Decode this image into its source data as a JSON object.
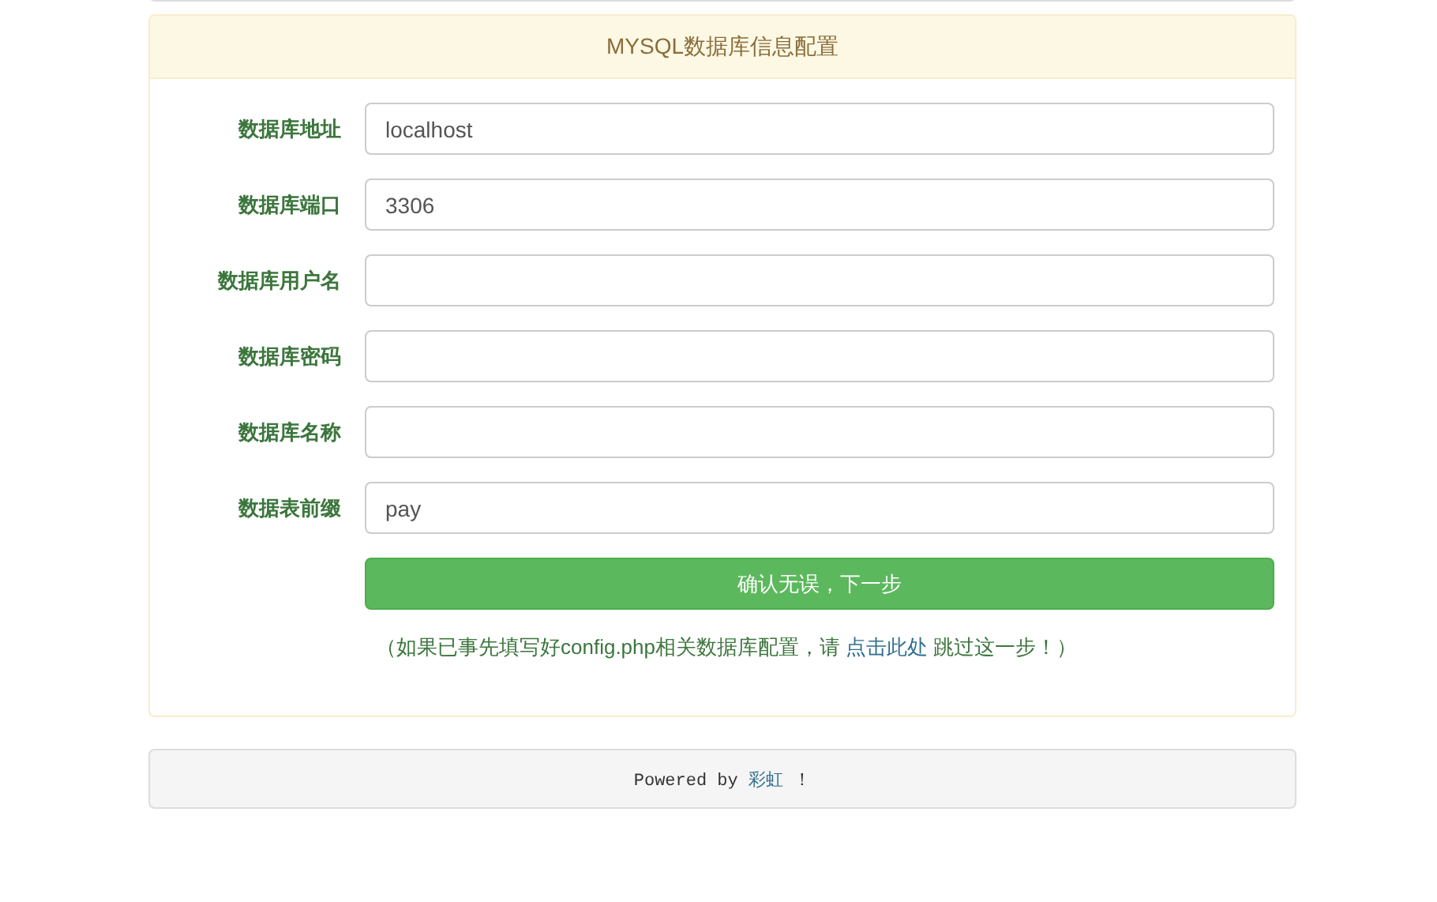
{
  "panel": {
    "title": "MYSQL数据库信息配置"
  },
  "fields": [
    {
      "label": "数据库地址",
      "value": "localhost"
    },
    {
      "label": "数据库端口",
      "value": "3306"
    },
    {
      "label": "数据库用户名"
    },
    {
      "label": "数据库密码"
    },
    {
      "label": "数据库名称"
    },
    {
      "label": "数据表前缀",
      "value": "pay"
    }
  ],
  "submit_button": "确认无误，下一步",
  "note": {
    "before": "（如果已事先填写好config.php相关数据库配置，请 ",
    "link": "点击此处",
    "after": " 跳过这一步！）"
  },
  "footer": {
    "before": "Powered by ",
    "link": "彩虹",
    "after": " ！"
  }
}
